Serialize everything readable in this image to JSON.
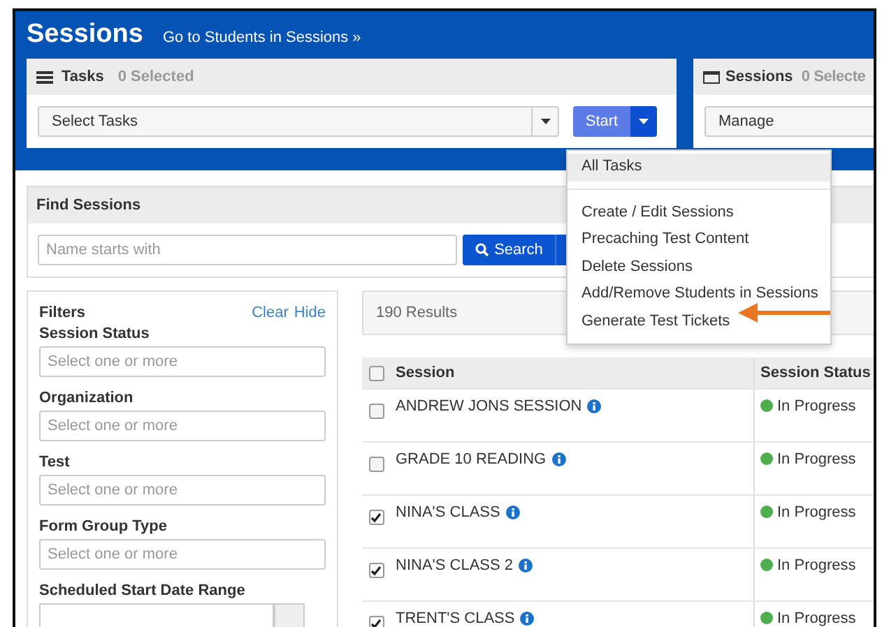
{
  "header": {
    "title": "Sessions",
    "link": "Go to Students in Sessions »"
  },
  "tasks_card": {
    "title": "Tasks",
    "count": "0 Selected",
    "select": {
      "placeholder": "Select Tasks"
    },
    "start_button": "Start"
  },
  "sessions_card": {
    "title": "Sessions",
    "count": "0 Selecte",
    "select": {
      "value": "Manage"
    }
  },
  "task_menu": {
    "items": [
      {
        "label": "All Tasks",
        "kind": "head",
        "highlighted": true,
        "pointed": false
      },
      {
        "label": "Create / Edit Sessions",
        "kind": "item",
        "highlighted": false,
        "pointed": false
      },
      {
        "label": "Precaching Test Content",
        "kind": "item",
        "highlighted": false,
        "pointed": false
      },
      {
        "label": "Delete Sessions",
        "kind": "item",
        "highlighted": false,
        "pointed": false
      },
      {
        "label": "Add/Remove Students in Sessions",
        "kind": "item",
        "highlighted": false,
        "pointed": false
      },
      {
        "label": "Generate Test Tickets",
        "kind": "item",
        "highlighted": false,
        "pointed": true
      }
    ]
  },
  "find_sessions": {
    "title": "Find Sessions",
    "search": {
      "placeholder": "Name starts with"
    },
    "search_button": "Search"
  },
  "filters": {
    "title": "Filters",
    "clear": "Clear",
    "hide": "Hide",
    "groups": [
      {
        "label": "Session Status",
        "placeholder": "Select one or more"
      },
      {
        "label": "Organization",
        "placeholder": "Select one or more"
      },
      {
        "label": "Test",
        "placeholder": "Select one or more"
      },
      {
        "label": "Form Group Type",
        "placeholder": "Select one or more"
      }
    ],
    "date_range_label": "Scheduled Start Date Range"
  },
  "results": {
    "count": "190 Results",
    "select_all": {
      "checked": false
    },
    "columns": [
      "Session",
      "Session Status"
    ],
    "rows": [
      {
        "name": "ANDREW JONS SESSION",
        "checked": false,
        "status": "In Progress"
      },
      {
        "name": "GRADE 10 READING",
        "checked": false,
        "status": "In Progress"
      },
      {
        "name": "NINA'S CLASS",
        "checked": true,
        "status": "In Progress"
      },
      {
        "name": "NINA'S CLASS 2",
        "checked": true,
        "status": "In Progress"
      },
      {
        "name": "TRENT'S CLASS",
        "checked": true,
        "status": "In Progress"
      }
    ]
  }
}
